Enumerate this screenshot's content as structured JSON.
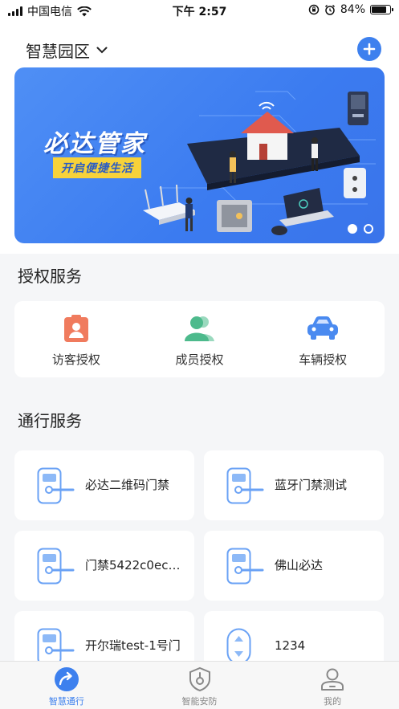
{
  "status_bar": {
    "carrier": "中国电信",
    "time": "下午 2:57",
    "battery": "84%"
  },
  "header": {
    "park_name": "智慧园区"
  },
  "banner": {
    "title": "必达管家",
    "subtitle": "开启便捷生活",
    "page_count": 2,
    "active_page": 1
  },
  "auth_section": {
    "title": "授权服务",
    "items": [
      {
        "label": "访客授权",
        "icon": "visitor-badge-icon",
        "color": "#f07b5e"
      },
      {
        "label": "成员授权",
        "icon": "members-icon",
        "color": "#4dba8c"
      },
      {
        "label": "车辆授权",
        "icon": "car-icon",
        "color": "#4a8af0"
      }
    ]
  },
  "pass_section": {
    "title": "通行服务",
    "items": [
      {
        "name": "必达二维码门禁",
        "icon": "door-lock-icon"
      },
      {
        "name": "蓝牙门禁测试",
        "icon": "door-lock-icon"
      },
      {
        "name": "门禁5422c0ec…",
        "icon": "door-lock-icon"
      },
      {
        "name": "佛山必达",
        "icon": "door-lock-icon"
      },
      {
        "name": "开尔瑞test-1号门",
        "icon": "door-lock-icon"
      },
      {
        "name": "1234",
        "icon": "elevator-icon"
      }
    ]
  },
  "tab_bar": {
    "tabs": [
      {
        "label": "智慧通行",
        "icon": "pass-arrow-icon",
        "active": true
      },
      {
        "label": "智能安防",
        "icon": "shield-icon",
        "active": false
      },
      {
        "label": "我的",
        "icon": "profile-icon",
        "active": false
      }
    ]
  },
  "colors": {
    "accent": "#3d80ee",
    "banner_bg": "#4a88f2",
    "banner_tag": "#f7d23a"
  }
}
